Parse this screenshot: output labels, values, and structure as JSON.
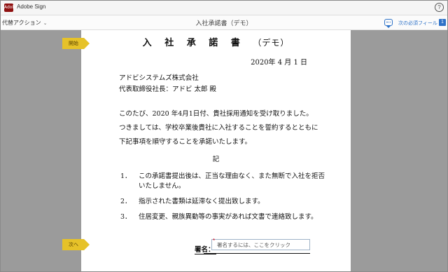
{
  "app": {
    "name": "Adobe Sign",
    "logo_text": "Adobe"
  },
  "toolbar": {
    "action_menu": "代替アクション",
    "document_title": "入社承諾書（デモ）",
    "next_required_label": "次の必須フィールド",
    "required_count": "1"
  },
  "document": {
    "title": "入 社 承 諾 書",
    "title_suffix": "（デモ）",
    "date": "2020年 4 月 1 日",
    "recipient_company": "アドビシステムズ株式会社",
    "recipient_person": "代表取締役社長：アドビ 太郎 殿",
    "body": [
      "このたび、2020 年4月1日付、貴社採用通知を受け取りました。",
      "つきましては、学校卒業後貴社に入社することを誓約するとともに",
      "下記事項を順守することを承諾いたします。"
    ],
    "ki": "記",
    "items": [
      {
        "num": "1．",
        "lines": [
          "この承諾書提出後は、正当な理由なく、また無断で入社を拒否",
          "いたしません。"
        ]
      },
      {
        "num": "2．",
        "lines": [
          "指示された書類は延滞なく提出致します。"
        ]
      },
      {
        "num": "3．",
        "lines": [
          "住居変更、親族異動等の事実があれば文書で連絡致します。"
        ]
      }
    ],
    "signature_label": "署名：",
    "signature_placeholder": "署名するには、ここをクリック",
    "required_marker": "*"
  },
  "tags": {
    "start": "開始",
    "next": "次へ"
  },
  "colors": {
    "accent_blue": "#2e72c8",
    "tag_yellow": "#e6c229",
    "logo_red": "#8f1010"
  },
  "icons": {
    "help": "help-icon",
    "chat": "comment-icon",
    "dropdown": "chevron-down-icon"
  }
}
